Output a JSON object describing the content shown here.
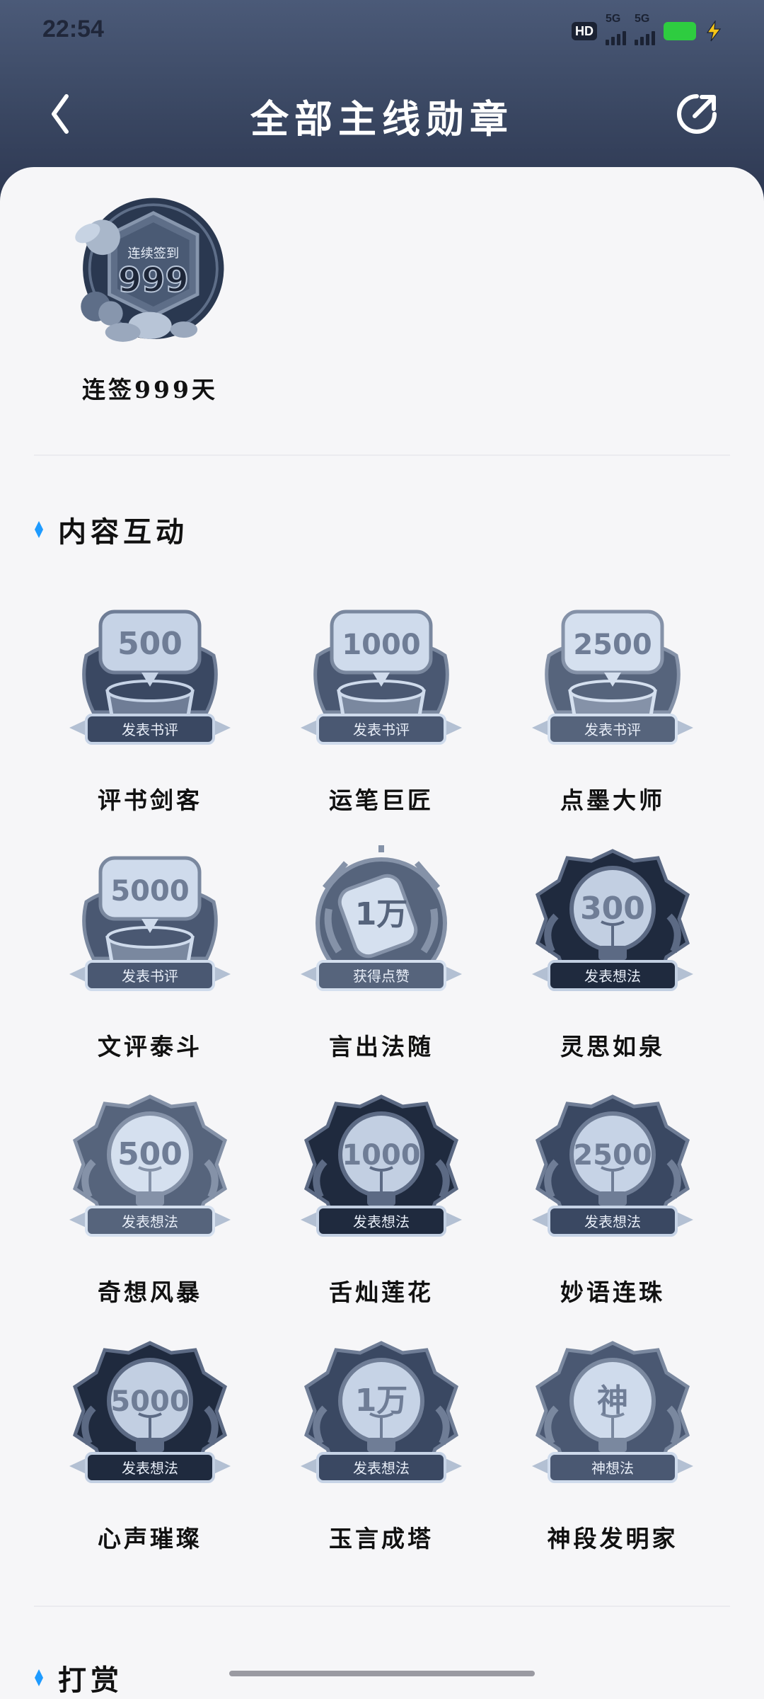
{
  "status_bar": {
    "time": "22:54",
    "hd_label": "HD",
    "network_1": "5G",
    "network_2": "5G",
    "battery_color": "#2ecc40"
  },
  "nav": {
    "back_icon": "chevron-left-icon",
    "title": "全部主线勋章",
    "share_icon": "share-icon"
  },
  "featured_badge": {
    "ribbon_text": "连续签到",
    "number": "999",
    "label": "连签999天"
  },
  "sections": [
    {
      "title": "内容互动",
      "badges": [
        {
          "number": "500",
          "ribbon": "发表书评",
          "label": "评书剑客",
          "kind": "review"
        },
        {
          "number": "1000",
          "ribbon": "发表书评",
          "label": "运笔巨匠",
          "kind": "review"
        },
        {
          "number": "2500",
          "ribbon": "发表书评",
          "label": "点墨大师",
          "kind": "review"
        },
        {
          "number": "5000",
          "ribbon": "发表书评",
          "label": "文评泰斗",
          "kind": "review"
        },
        {
          "number": "1万",
          "ribbon": "获得点赞",
          "label": "言出法随",
          "kind": "like"
        },
        {
          "number": "300",
          "ribbon": "发表想法",
          "label": "灵思如泉",
          "kind": "idea"
        },
        {
          "number": "500",
          "ribbon": "发表想法",
          "label": "奇想风暴",
          "kind": "idea"
        },
        {
          "number": "1000",
          "ribbon": "发表想法",
          "label": "舌灿莲花",
          "kind": "idea"
        },
        {
          "number": "2500",
          "ribbon": "发表想法",
          "label": "妙语连珠",
          "kind": "idea"
        },
        {
          "number": "5000",
          "ribbon": "发表想法",
          "label": "心声璀璨",
          "kind": "idea"
        },
        {
          "number": "1万",
          "ribbon": "发表想法",
          "label": "玉言成塔",
          "kind": "idea"
        },
        {
          "number": "神",
          "ribbon": "神想法",
          "label": "神段发明家",
          "kind": "idea"
        }
      ]
    },
    {
      "title": "打赏"
    }
  ],
  "colors": {
    "accent_dot": "#1e9bff",
    "header_top": "#4b5a78",
    "header_bottom": "#2c3650",
    "badge_dark": "#25324a",
    "badge_mid": "#6d7b94",
    "badge_light": "#c9d6ea"
  }
}
